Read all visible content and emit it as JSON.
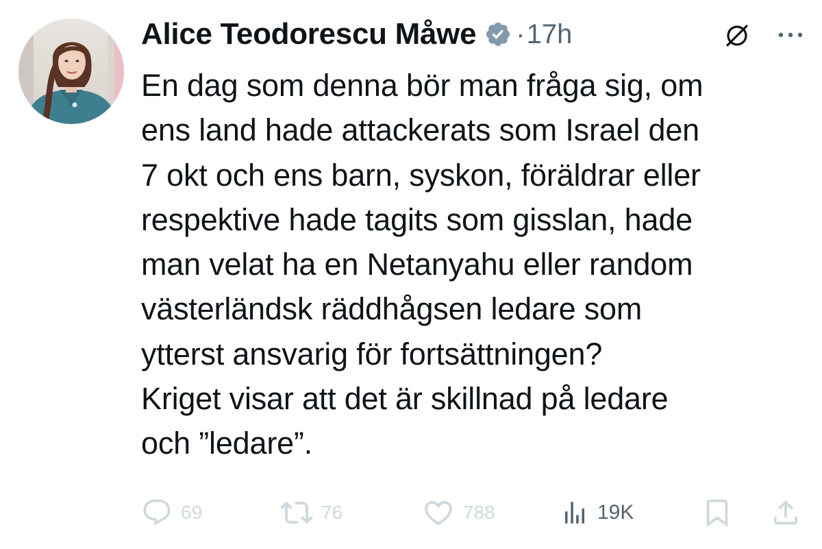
{
  "tweet": {
    "author": {
      "name": "Alice Teodorescu Måwe",
      "verified": true
    },
    "separator": "·",
    "time": "17h",
    "text_lines": [
      "En dag som denna bör man fråga sig, om",
      "ens land hade attackerats som Israel den",
      "7 okt och ens barn, syskon, föräldrar eller",
      "respektive hade tagits som gisslan, hade",
      "man velat ha en Netanyahu eller random",
      "västerländsk räddhågsen ledare som",
      "ytterst ansvarig för fortsättningen?",
      "Kriget visar att det är skillnad på ledare",
      "och ”ledare”."
    ],
    "stats": {
      "replies": "69",
      "reposts": "76",
      "likes": "788",
      "views": "19K"
    }
  },
  "icons": {
    "verified": "verified-badge-icon",
    "grok": "grok-icon",
    "more": "more-icon",
    "reply": "reply-icon",
    "repost": "repost-icon",
    "like": "heart-icon",
    "views": "views-icon",
    "bookmark": "bookmark-icon",
    "share": "share-icon"
  },
  "colors": {
    "text": "#0f1419",
    "muted": "#536471",
    "faded_actions": "#cfd9de",
    "verified_badge": "#829aab"
  }
}
